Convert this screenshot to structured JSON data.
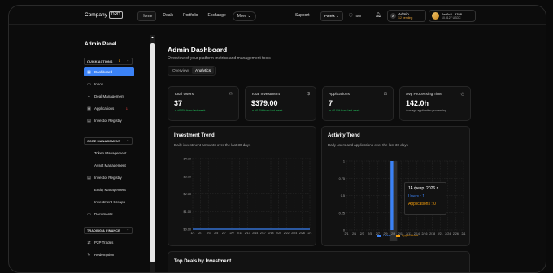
{
  "header": {
    "logo_text": "Company",
    "logo_badge": "DRD",
    "nav": [
      {
        "label": "Home",
        "active": true
      },
      {
        "label": "Deals"
      },
      {
        "label": "Portfolio"
      },
      {
        "label": "Exchange"
      },
      {
        "label": "More"
      }
    ],
    "support_label": "Support",
    "network_select": "Pareix",
    "tour_label": "Tour",
    "admin_initial": "A",
    "admin_name": "Admin",
    "admin_pending": "12 pending",
    "wallet_address": "0xc6c3...5768",
    "wallet_balance": "10.3127 USDC"
  },
  "sidebar": {
    "title": "Admin Panel",
    "sections": [
      {
        "label": "QUICK ACTIONS",
        "badge": "1",
        "items": [
          {
            "label": "Dashboard",
            "icon": "dashboard-icon",
            "active": true
          },
          {
            "label": "Inbox",
            "icon": "inbox-icon"
          },
          {
            "label": "Deal Management",
            "icon": "deal-icon"
          },
          {
            "label": "Applications",
            "icon": "applications-icon",
            "badge": "1"
          },
          {
            "label": "Investor Registry",
            "icon": "registry-icon"
          }
        ]
      },
      {
        "label": "CORE MANAGEMENT",
        "items": [
          {
            "label": "Token Management",
            "icon": ""
          },
          {
            "label": "Asset Management",
            "icon": "asset-icon"
          },
          {
            "label": "Investor Registry",
            "icon": "registry-icon"
          },
          {
            "label": "Entity Management",
            "icon": "entity-icon"
          },
          {
            "label": "Investment Groups",
            "icon": "groups-icon"
          },
          {
            "label": "Documents",
            "icon": "documents-icon"
          }
        ]
      },
      {
        "label": "TRADING & FINANCE",
        "items": [
          {
            "label": "P2P Trades",
            "icon": "trades-icon"
          },
          {
            "label": "Redemption",
            "icon": "redemption-icon"
          }
        ]
      }
    ]
  },
  "main": {
    "title": "Admin Dashboard",
    "subtitle": "Overview of your platform metrics and management tools",
    "tabs": [
      {
        "label": "Overview"
      },
      {
        "label": "Analytics",
        "active": true
      }
    ],
    "stats": [
      {
        "label": "Total Users",
        "value": "37",
        "delta": "↗ +0.0% from last week",
        "icon": "users-icon"
      },
      {
        "label": "Total Investment",
        "value": "$379.00",
        "delta": "↗ +0.0% from last week",
        "icon": "dollar-icon"
      },
      {
        "label": "Applications",
        "value": "7",
        "delta": "↗ +0.0% from last week",
        "icon": "briefcase-icon"
      },
      {
        "label": "Avg Processing Time",
        "value": "142.0h",
        "delta": "Average application processing",
        "icon": "clock-icon"
      }
    ],
    "deals_title": "Top Deals by Investment"
  },
  "chart_data": [
    {
      "type": "area",
      "title": "Investment Trend",
      "subtitle": "Daily investment amounts over the last 30 days",
      "ylim": [
        0,
        4
      ],
      "y_tick_labels": [
        "$0.00",
        "$1.00",
        "$2.00",
        "$3.00",
        "$4.00"
      ],
      "x_tick_labels": [
        "1/1",
        "2/1",
        "2/3",
        "2/5",
        "2/7",
        "2/9",
        "2/11",
        "2/13",
        "2/14",
        "2/17",
        "2/18",
        "2/20",
        "2/22",
        "2/24",
        "2/26",
        "2/1"
      ],
      "series": [
        {
          "values": [
            0,
            0,
            0,
            0,
            0,
            0,
            0,
            0,
            0,
            0,
            0,
            0,
            0,
            0,
            0,
            0
          ]
        }
      ],
      "color": "#3b82f6"
    },
    {
      "type": "bar",
      "title": "Activity Trend",
      "subtitle": "Daily users and applications over the last 30 days",
      "ylim": [
        0,
        1
      ],
      "y_tick_labels": [
        "0",
        "0.25",
        "0.5",
        "0.75",
        "1"
      ],
      "x_tick_labels": [
        "2/1",
        "2/1",
        "2/3",
        "2/5",
        "2/7",
        "2/9",
        "2/9",
        "2/11",
        "2/13",
        "2/14",
        "2/16",
        "2/18",
        "2/21",
        "2/24",
        "2/26",
        "2/1"
      ],
      "highlight_index": 6,
      "series": [
        {
          "name": "Users",
          "values": [
            0,
            0,
            0,
            0,
            0,
            0,
            1,
            0,
            0,
            0,
            0,
            0,
            0,
            0,
            0,
            0
          ],
          "color": "#3b82f6"
        },
        {
          "name": "Applications",
          "values": [
            0,
            0,
            0,
            0,
            0,
            0,
            0,
            0,
            0,
            0,
            0,
            0,
            0,
            0,
            0,
            0
          ],
          "color": "#f59e0b"
        }
      ],
      "tooltip": {
        "date": "14 февр. 2026 г.",
        "users": "Users : 1",
        "applications": "Applications : 0"
      }
    }
  ]
}
